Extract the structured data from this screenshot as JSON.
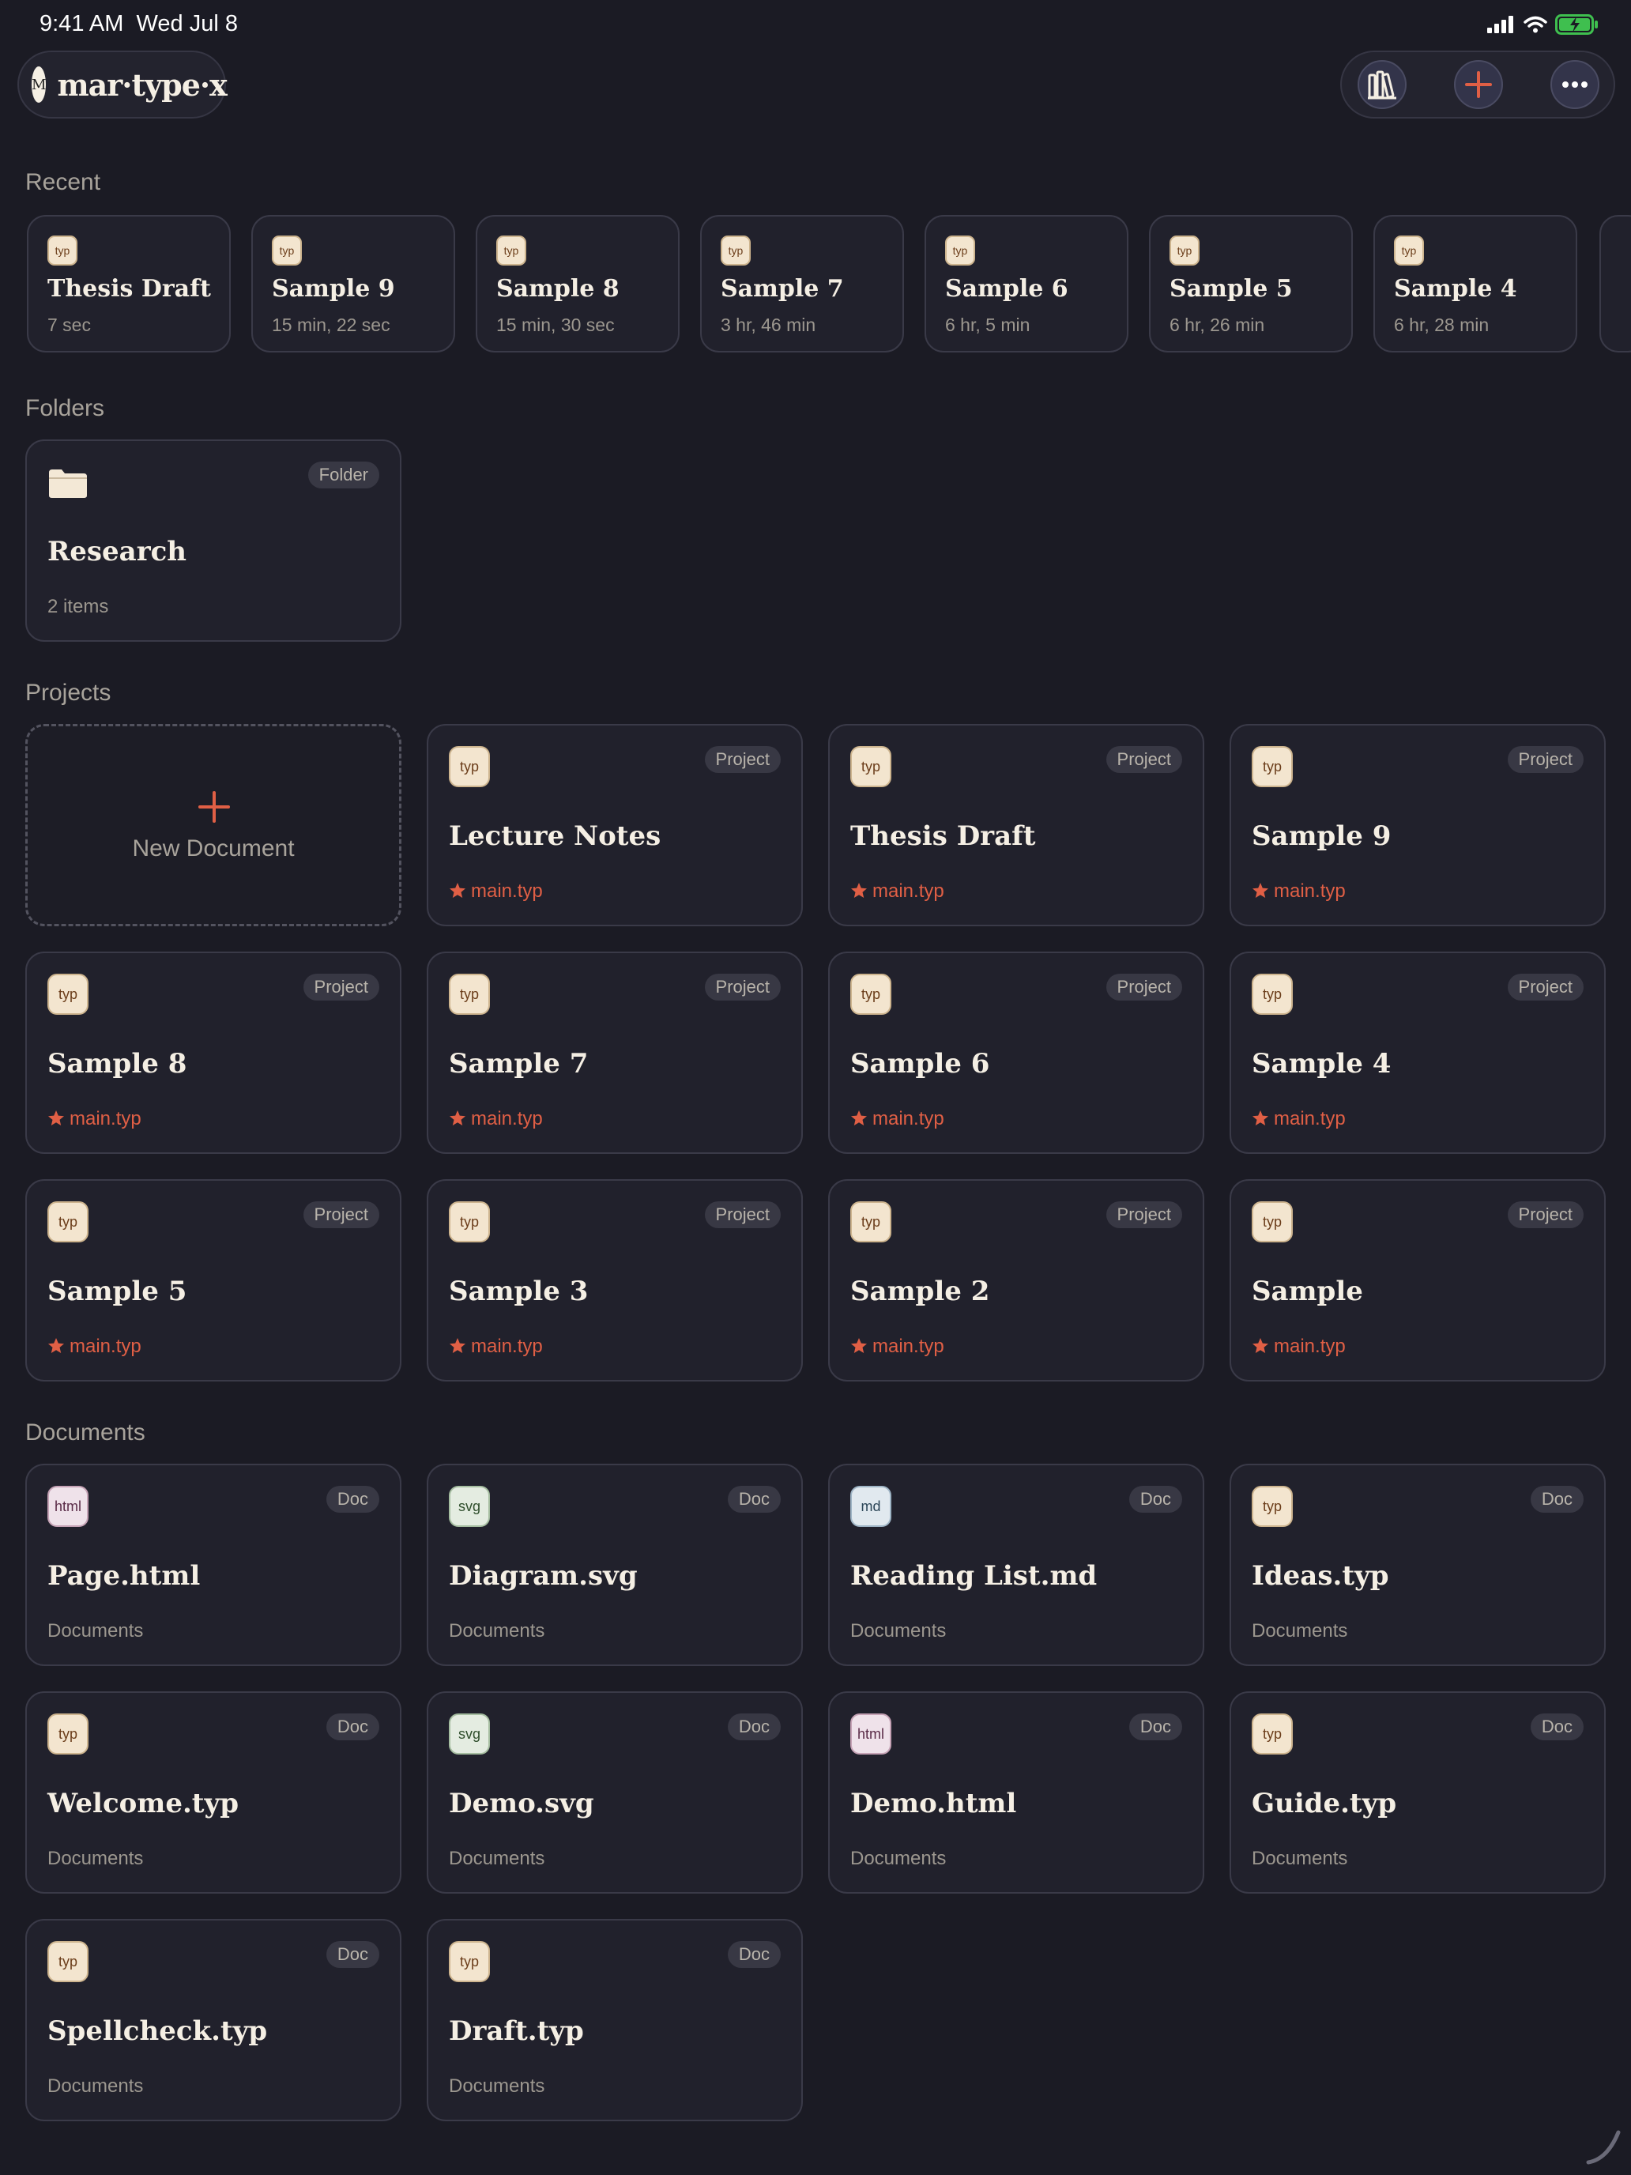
{
  "status": {
    "time": "9:41 AM",
    "date": "Wed Jul 8"
  },
  "app": {
    "logo_mark": "M",
    "logo_text": "mar·type·x"
  },
  "toolbar": {
    "library_icon": "library-icon",
    "add_icon": "plus-icon",
    "more_icon": "ellipsis-icon"
  },
  "colors": {
    "background": "#1b1b24",
    "card": "#21212c",
    "accent": "#e05f45",
    "text": "#f5efe4",
    "muted": "#9c978f"
  },
  "sections": {
    "recent": "Recent",
    "folders": "Folders",
    "projects": "Projects",
    "documents": "Documents"
  },
  "recent": [
    {
      "title": "Thesis Draft",
      "time": "7 sec",
      "icon": "typ"
    },
    {
      "title": "Sample 9",
      "time": "15 min, 22 sec",
      "icon": "typ"
    },
    {
      "title": "Sample 8",
      "time": "15 min, 30 sec",
      "icon": "typ"
    },
    {
      "title": "Sample 7",
      "time": "3 hr, 46 min",
      "icon": "typ"
    },
    {
      "title": "Sample 6",
      "time": "6 hr, 5 min",
      "icon": "typ"
    },
    {
      "title": "Sample 5",
      "time": "6 hr, 26 min",
      "icon": "typ"
    },
    {
      "title": "Sample 4",
      "time": "6 hr, 28 min",
      "icon": "typ"
    }
  ],
  "folders": [
    {
      "title": "Research",
      "count": "2 items",
      "badge": "Folder"
    }
  ],
  "new_document": {
    "label": "New Document"
  },
  "projects": [
    {
      "title": "Lecture Notes",
      "file": "main.typ",
      "badge": "Project",
      "icon": "typ"
    },
    {
      "title": "Thesis Draft",
      "file": "main.typ",
      "badge": "Project",
      "icon": "typ"
    },
    {
      "title": "Sample 9",
      "file": "main.typ",
      "badge": "Project",
      "icon": "typ"
    },
    {
      "title": "Sample 8",
      "file": "main.typ",
      "badge": "Project",
      "icon": "typ"
    },
    {
      "title": "Sample 7",
      "file": "main.typ",
      "badge": "Project",
      "icon": "typ"
    },
    {
      "title": "Sample 6",
      "file": "main.typ",
      "badge": "Project",
      "icon": "typ"
    },
    {
      "title": "Sample 4",
      "file": "main.typ",
      "badge": "Project",
      "icon": "typ"
    },
    {
      "title": "Sample 5",
      "file": "main.typ",
      "badge": "Project",
      "icon": "typ"
    },
    {
      "title": "Sample 3",
      "file": "main.typ",
      "badge": "Project",
      "icon": "typ"
    },
    {
      "title": "Sample 2",
      "file": "main.typ",
      "badge": "Project",
      "icon": "typ"
    },
    {
      "title": "Sample",
      "file": "main.typ",
      "badge": "Project",
      "icon": "typ"
    }
  ],
  "documents": [
    {
      "title": "Page.html",
      "location": "Documents",
      "badge": "Doc",
      "icon": "html"
    },
    {
      "title": "Diagram.svg",
      "location": "Documents",
      "badge": "Doc",
      "icon": "svg"
    },
    {
      "title": "Reading List.md",
      "location": "Documents",
      "badge": "Doc",
      "icon": "md"
    },
    {
      "title": "Ideas.typ",
      "location": "Documents",
      "badge": "Doc",
      "icon": "typ"
    },
    {
      "title": "Welcome.typ",
      "location": "Documents",
      "badge": "Doc",
      "icon": "typ"
    },
    {
      "title": "Demo.svg",
      "location": "Documents",
      "badge": "Doc",
      "icon": "svg"
    },
    {
      "title": "Demo.html",
      "location": "Documents",
      "badge": "Doc",
      "icon": "html"
    },
    {
      "title": "Guide.typ",
      "location": "Documents",
      "badge": "Doc",
      "icon": "typ"
    },
    {
      "title": "Spellcheck.typ",
      "location": "Documents",
      "badge": "Doc",
      "icon": "typ"
    },
    {
      "title": "Draft.typ",
      "location": "Documents",
      "badge": "Doc",
      "icon": "typ"
    }
  ]
}
